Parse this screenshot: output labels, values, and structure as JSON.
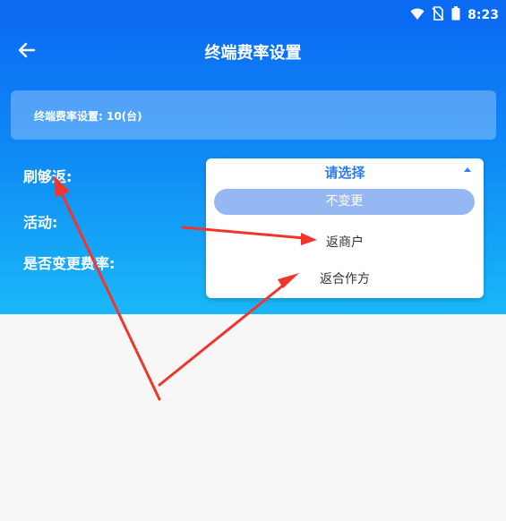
{
  "status": {
    "time": "8:23"
  },
  "nav": {
    "title": "终端费率设置"
  },
  "info": {
    "text": "终端费率设置: 10(台)"
  },
  "form": {
    "labels": [
      "刷够返:",
      "活动:",
      "是否变更费率:"
    ]
  },
  "dropdown": {
    "placeholder": "请选择",
    "options": [
      "不变更",
      "返商户",
      "返合作方"
    ],
    "selected_index": 0
  },
  "colors": {
    "header_top": "#0b69f3",
    "header_bottom": "#19b8f8",
    "accent": "#2f7cf0",
    "selected_option_bg": "#95b8f2",
    "annotation_arrow": "#f0362c"
  }
}
